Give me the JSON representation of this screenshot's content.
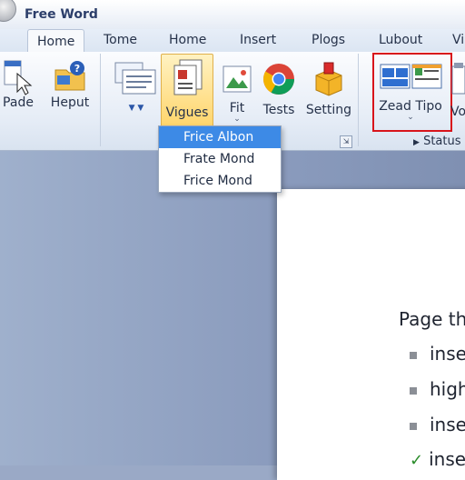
{
  "window": {
    "title": "Free Word"
  },
  "tabs": [
    {
      "label": "Home",
      "active": true
    },
    {
      "label": "Tome"
    },
    {
      "label": "Home"
    },
    {
      "label": "Insert"
    },
    {
      "label": "Plogs"
    },
    {
      "label": "Lubout"
    },
    {
      "label": "Vi"
    }
  ],
  "ribbon": {
    "buttons": {
      "pade": "Pade",
      "heput": "Heput",
      "vigues": "Vigues",
      "fit": "Fit",
      "tests": "Tests",
      "setting": "Setting",
      "zead_tipo": "Zead Tipo",
      "vo": "Vo"
    },
    "status_group_label": "Status"
  },
  "dropdown": {
    "items": [
      "Frice Albon",
      "Frate Mond",
      "Frice Mond"
    ],
    "selected_index": 0
  },
  "document": {
    "heading": "Page th",
    "bullets": [
      "inse",
      "high",
      "inse",
      "inse"
    ],
    "last_bullet_checked": true
  },
  "colors": {
    "highlight_box": "#d8141b",
    "dropdown_selection": "#3d8ae6",
    "accent": "#f0b429"
  }
}
